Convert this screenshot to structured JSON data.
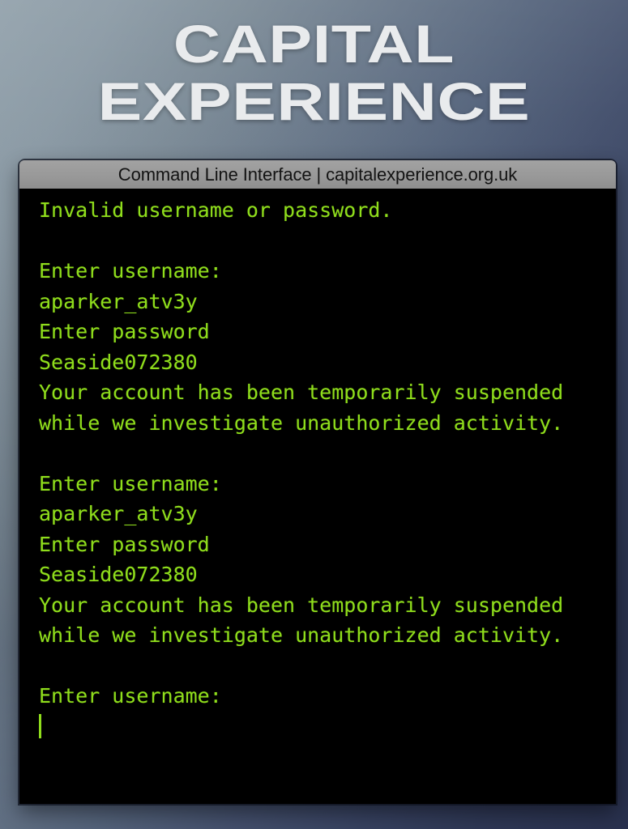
{
  "brand": {
    "line1": "CAPITAL",
    "line2": "EXPERIENCE",
    "color": "#e9ebed"
  },
  "background": {
    "gradient_from": "#93a2ac",
    "gradient_to": "#2a3250",
    "direction": "top-left light to bottom-right dark navy"
  },
  "terminal": {
    "title": "Command Line Interface | capitalexperience.org.uk",
    "titlebar_color": "#989898",
    "titlebar_text_color": "#131313",
    "background_color": "#000000",
    "text_color": "#8fdd1c",
    "cursor": "|",
    "lines": [
      "Invalid username or password.",
      "",
      "Enter username:",
      "aparker_atv3y",
      "Enter password",
      "Seaside072380",
      "Your account has been temporarily suspended while we investigate unauthorized activity.",
      "",
      "Enter username:",
      "aparker_atv3y",
      "Enter password",
      "Seaside072380",
      "Your account has been temporarily suspended while we investigate unauthorized activity.",
      "",
      "Enter username:"
    ],
    "credentials": {
      "username": "aparker_atv3y",
      "password": "Seaside072380"
    },
    "prompts": {
      "username_prompt": "Enter username:",
      "password_prompt": "Enter password"
    },
    "messages": {
      "invalid": "Invalid username or password.",
      "suspended": "Your account has been temporarily suspended while we investigate unauthorized activity."
    }
  }
}
